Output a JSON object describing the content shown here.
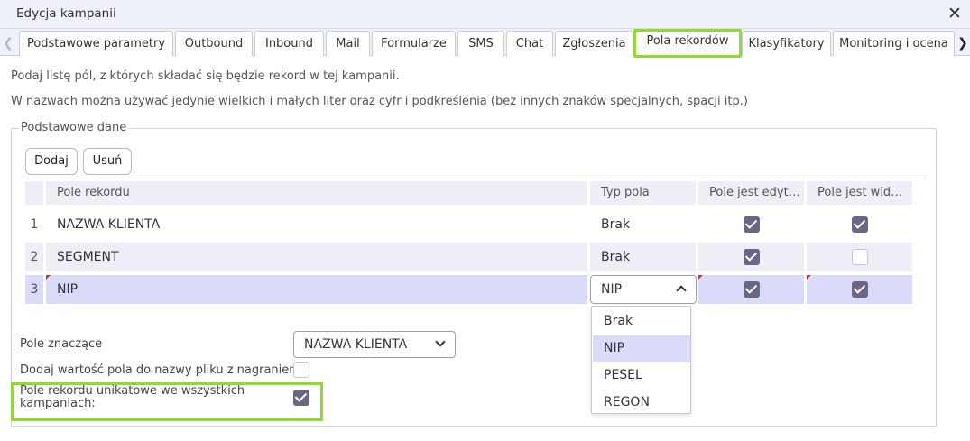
{
  "window": {
    "title": "Edycja kampanii"
  },
  "tabs": [
    {
      "label": "Podstawowe parametry"
    },
    {
      "label": "Outbound"
    },
    {
      "label": "Inbound"
    },
    {
      "label": "Mail"
    },
    {
      "label": "Formularze"
    },
    {
      "label": "SMS"
    },
    {
      "label": "Chat"
    },
    {
      "label": "Zgłoszenia"
    },
    {
      "label": "Pola rekordów",
      "active": true
    },
    {
      "label": "Klasyfikatory"
    },
    {
      "label": "Monitoring i ocena"
    }
  ],
  "info": {
    "line1": "Podaj listę pól, z których składać się będzie rekord w tej kampanii.",
    "line2": "W nazwach można używać jedynie wielkich i małych liter oraz cyfr i podkreślenia (bez innych znaków specjalnych, spacji itp.)"
  },
  "section": {
    "legend": "Podstawowe dane",
    "add_label": "Dodaj",
    "remove_label": "Usuń"
  },
  "grid": {
    "columns": [
      "Pole rekordu",
      "Typ pola",
      "Pole jest edyt…",
      "Pole jest wid…"
    ],
    "rows": [
      {
        "num": "1",
        "name": "NAZWA KLIENTA",
        "type": "Brak",
        "editable": true,
        "visible": true
      },
      {
        "num": "2",
        "name": "SEGMENT",
        "type": "Brak",
        "editable": true,
        "visible": false
      },
      {
        "num": "3",
        "name": "NIP",
        "type": "NIP",
        "editable": true,
        "visible": true,
        "selected": true
      }
    ]
  },
  "type_dropdown": {
    "options": [
      "Brak",
      "NIP",
      "PESEL",
      "REGON"
    ],
    "selected": "NIP"
  },
  "settings": {
    "significant_label": "Pole znaczące",
    "significant_value": "NAZWA KLIENTA",
    "add_to_filename_label": "Dodaj wartość pola do nazwy pliku z nagraniem:",
    "add_to_filename_checked": false,
    "unique_label": "Pole rekordu unikatowe we wszystkich kampaniach:",
    "unique_checked": true
  },
  "colors": {
    "accent_highlight": "#92d930",
    "checkbox_checked": "#6d6585",
    "selected_row": "#d9dbf8"
  }
}
